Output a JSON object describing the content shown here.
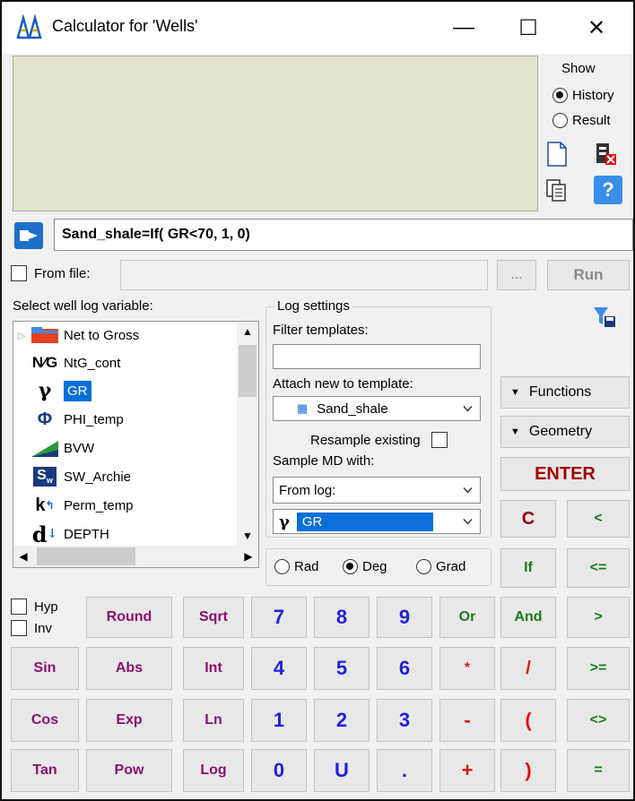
{
  "window": {
    "title": "Calculator for 'Wells'",
    "min": "—",
    "max": "☐",
    "close": "✕"
  },
  "show": {
    "label": "Show",
    "history": "History",
    "result": "Result",
    "selected": "History"
  },
  "formula": "Sand_shale=If( GR<70, 1, 0)",
  "from_file": {
    "label": "From file:",
    "browse": "...",
    "run": "Run"
  },
  "variables": {
    "label": "Select well log variable:",
    "items": [
      {
        "label": "Net to Gross",
        "icon": "folder-icon",
        "selected": false
      },
      {
        "label": "NtG_cont",
        "icon": "ntg-icon",
        "selected": false
      },
      {
        "label": "GR",
        "icon": "gamma-icon",
        "selected": true
      },
      {
        "label": "PHI_temp",
        "icon": "phi-icon",
        "selected": false
      },
      {
        "label": "BVW",
        "icon": "bvw-icon",
        "selected": false
      },
      {
        "label": "SW_Archie",
        "icon": "sw-icon",
        "selected": false
      },
      {
        "label": "Perm_temp",
        "icon": "perm-icon",
        "selected": false
      },
      {
        "label": "DEPTH",
        "icon": "depth-icon",
        "selected": false
      }
    ]
  },
  "log_settings": {
    "title": "Log settings",
    "filter_label": "Filter templates:",
    "filter_value": "",
    "attach_label": "Attach new to template:",
    "attach_value": "Sand_shale",
    "resample_label": "Resample existing",
    "sample_label": "Sample MD with:",
    "sample_value": "From log:",
    "log_value": "GR"
  },
  "angle": {
    "rad": "Rad",
    "deg": "Deg",
    "grad": "Grad",
    "selected": "Deg"
  },
  "side": {
    "functions": "Functions",
    "geometry": "Geometry",
    "enter": "ENTER"
  },
  "checks": {
    "hyp": "Hyp",
    "inv": "Inv"
  },
  "keys": {
    "c": "C",
    "lt": "<",
    "if": "If",
    "le": "<=",
    "round": "Round",
    "sqrt": "Sqrt",
    "k7": "7",
    "k8": "8",
    "k9": "9",
    "or": "Or",
    "and": "And",
    "gt": ">",
    "sin": "Sin",
    "abs": "Abs",
    "int": "Int",
    "k4": "4",
    "k5": "5",
    "k6": "6",
    "mul": "*",
    "div": "/",
    "ge": ">=",
    "cos": "Cos",
    "exp": "Exp",
    "ln": "Ln",
    "k1": "1",
    "k2": "2",
    "k3": "3",
    "minus": "-",
    "lparen": "(",
    "ne": "<>",
    "tan": "Tan",
    "pow": "Pow",
    "log": "Log",
    "k0": "0",
    "u": "U",
    "dot": ".",
    "plus": "+",
    "rparen": ")",
    "eq": "="
  },
  "colors": {
    "history_bg": "#e3e4cc",
    "selection": "#0a6fd8",
    "number": "#1f1fe0",
    "function": "#8a1070",
    "logic": "#1a7a1a",
    "operator": "#e01010"
  }
}
